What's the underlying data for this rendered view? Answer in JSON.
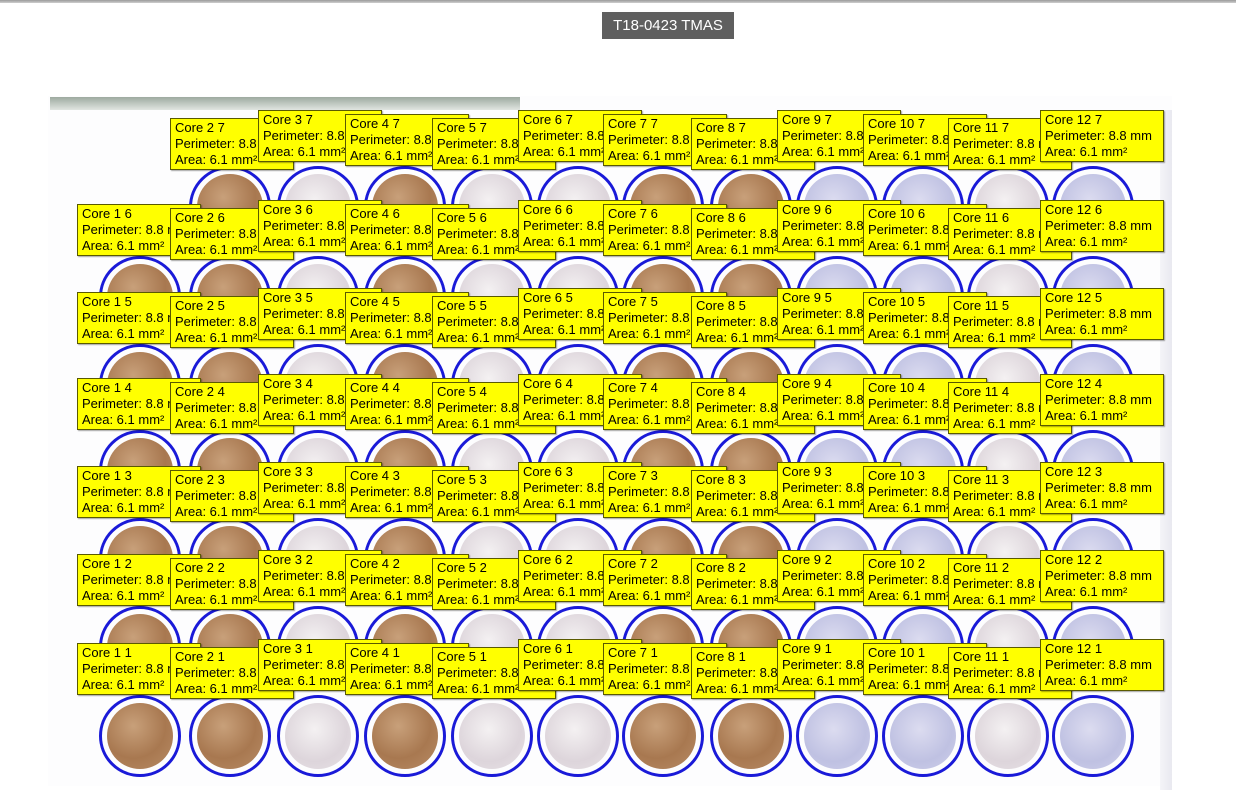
{
  "title": "T18-0423 TMAS",
  "label_template": {
    "perimeter": "Perimeter: 8.8 mm",
    "area": "Area: 6.1 mm²"
  },
  "colors": {
    "label_background": "#ffff00",
    "core_outline": "#1a1ad8",
    "title_background": "#5f5f5f"
  },
  "cores": [
    {
      "name": "Core 1 1",
      "stain": "brown"
    },
    {
      "name": "Core 2 1",
      "stain": "brown"
    },
    {
      "name": "Core 3 1",
      "stain": "pale"
    },
    {
      "name": "Core 4 1",
      "stain": "brown"
    },
    {
      "name": "Core 5 1",
      "stain": "pale"
    },
    {
      "name": "Core 6 1",
      "stain": "pale"
    },
    {
      "name": "Core 7 1",
      "stain": "brown"
    },
    {
      "name": "Core 8 1",
      "stain": "brown"
    },
    {
      "name": "Core 9 1",
      "stain": "blue"
    },
    {
      "name": "Core 10 1",
      "stain": "blue"
    },
    {
      "name": "Core 11 1",
      "stain": "pale"
    },
    {
      "name": "Core 12 1",
      "stain": "blue"
    },
    {
      "name": "Core 1 2",
      "stain": "brown"
    },
    {
      "name": "Core 2 2",
      "stain": "brown"
    },
    {
      "name": "Core 3 2",
      "stain": "pale"
    },
    {
      "name": "Core 4 2",
      "stain": "brown"
    },
    {
      "name": "Core 5 2",
      "stain": "pale"
    },
    {
      "name": "Core 6 2",
      "stain": "pale"
    },
    {
      "name": "Core 7 2",
      "stain": "brown"
    },
    {
      "name": "Core 8 2",
      "stain": "brown"
    },
    {
      "name": "Core 9 2",
      "stain": "blue"
    },
    {
      "name": "Core 10 2",
      "stain": "blue"
    },
    {
      "name": "Core 11 2",
      "stain": "pale"
    },
    {
      "name": "Core 12 2",
      "stain": "blue"
    },
    {
      "name": "Core 1 3",
      "stain": "brown"
    },
    {
      "name": "Core 2 3",
      "stain": "brown"
    },
    {
      "name": "Core 3 3",
      "stain": "pale"
    },
    {
      "name": "Core 4 3",
      "stain": "brown"
    },
    {
      "name": "Core 5 3",
      "stain": "pale"
    },
    {
      "name": "Core 6 3",
      "stain": "pale"
    },
    {
      "name": "Core 7 3",
      "stain": "brown"
    },
    {
      "name": "Core 8 3",
      "stain": "brown"
    },
    {
      "name": "Core 9 3",
      "stain": "blue"
    },
    {
      "name": "Core 10 3",
      "stain": "blue"
    },
    {
      "name": "Core 11 3",
      "stain": "pale"
    },
    {
      "name": "Core 12 3",
      "stain": "blue"
    },
    {
      "name": "Core 1 4",
      "stain": "brown"
    },
    {
      "name": "Core 2 4",
      "stain": "brown"
    },
    {
      "name": "Core 3 4",
      "stain": "pale"
    },
    {
      "name": "Core 4 4",
      "stain": "brown"
    },
    {
      "name": "Core 5 4",
      "stain": "pale"
    },
    {
      "name": "Core 6 4",
      "stain": "pale"
    },
    {
      "name": "Core 7 4",
      "stain": "brown"
    },
    {
      "name": "Core 8 4",
      "stain": "brown"
    },
    {
      "name": "Core 9 4",
      "stain": "blue"
    },
    {
      "name": "Core 10 4",
      "stain": "blue"
    },
    {
      "name": "Core 11 4",
      "stain": "pale"
    },
    {
      "name": "Core 12 4",
      "stain": "blue"
    },
    {
      "name": "Core 1 5",
      "stain": "brown"
    },
    {
      "name": "Core 2 5",
      "stain": "brown"
    },
    {
      "name": "Core 3 5",
      "stain": "pale"
    },
    {
      "name": "Core 4 5",
      "stain": "brown"
    },
    {
      "name": "Core 5 5",
      "stain": "pale"
    },
    {
      "name": "Core 6 5",
      "stain": "pale"
    },
    {
      "name": "Core 7 5",
      "stain": "brown"
    },
    {
      "name": "Core 8 5",
      "stain": "brown"
    },
    {
      "name": "Core 9 5",
      "stain": "blue"
    },
    {
      "name": "Core 10 5",
      "stain": "blue"
    },
    {
      "name": "Core 11 5",
      "stain": "pale"
    },
    {
      "name": "Core 12 5",
      "stain": "blue"
    },
    {
      "name": "Core 1 6",
      "stain": "brown"
    },
    {
      "name": "Core 2 6",
      "stain": "brown"
    },
    {
      "name": "Core 3 6",
      "stain": "pale"
    },
    {
      "name": "Core 4 6",
      "stain": "brown"
    },
    {
      "name": "Core 5 6",
      "stain": "pale"
    },
    {
      "name": "Core 6 6",
      "stain": "pale"
    },
    {
      "name": "Core 7 6",
      "stain": "brown"
    },
    {
      "name": "Core 8 6",
      "stain": "brown"
    },
    {
      "name": "Core 9 6",
      "stain": "blue"
    },
    {
      "name": "Core 10 6",
      "stain": "blue"
    },
    {
      "name": "Core 11 6",
      "stain": "pale"
    },
    {
      "name": "Core 12 6",
      "stain": "blue"
    },
    {
      "name": "Core 2 7",
      "stain": "brown"
    },
    {
      "name": "Core 3 7",
      "stain": "pale"
    },
    {
      "name": "Core 4 7",
      "stain": "brown"
    },
    {
      "name": "Core 5 7",
      "stain": "pale"
    },
    {
      "name": "Core 6 7",
      "stain": "pale"
    },
    {
      "name": "Core 7 7",
      "stain": "brown"
    },
    {
      "name": "Core 8 7",
      "stain": "brown"
    },
    {
      "name": "Core 9 7",
      "stain": "blue"
    },
    {
      "name": "Core 10 7",
      "stain": "blue"
    },
    {
      "name": "Core 11 7",
      "stain": "pale"
    },
    {
      "name": "Core 12 7",
      "stain": "blue"
    }
  ]
}
